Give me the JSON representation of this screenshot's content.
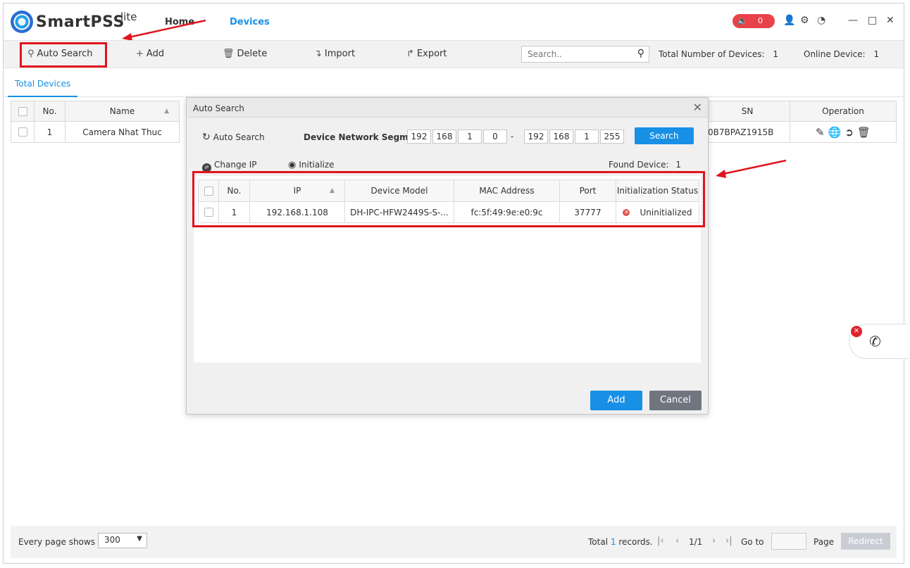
{
  "app": {
    "name": "SmartPSS",
    "suffix": "lite"
  },
  "nav": {
    "home": "Home",
    "devices": "Devices"
  },
  "header": {
    "alarm_count": "0"
  },
  "toolbar": {
    "auto_search": "Auto Search",
    "add": "Add",
    "delete": "Delete",
    "import": "Import",
    "export": "Export",
    "search_placeholder": "Search..",
    "total_label": "Total Number of Devices:",
    "total_value": "1",
    "online_label": "Online Device:",
    "online_value": "1"
  },
  "tabs": {
    "total_devices": "Total Devices"
  },
  "device_table": {
    "columns": {
      "no": "No.",
      "name": "Name",
      "sn": "SN",
      "operation": "Operation"
    },
    "rows": [
      {
        "no": "1",
        "name": "Camera Nhat Thuc",
        "sn": "0B7BPAZ1915B"
      }
    ]
  },
  "dialog": {
    "title": "Auto Search",
    "auto_search": "Auto Search",
    "segment_label": "Device Network Segm...",
    "start_ip": [
      "192",
      "168",
      "1",
      "0"
    ],
    "end_ip": [
      "192",
      "168",
      "1",
      "255"
    ],
    "dash": "-",
    "search_button": "Search",
    "change_ip": "Change IP",
    "initialize": "Initialize",
    "found_label": "Found Device:",
    "found_value": "1",
    "columns": {
      "no": "No.",
      "ip": "IP",
      "model": "Device Model",
      "mac": "MAC Address",
      "port": "Port",
      "status": "Initialization Status"
    },
    "rows": [
      {
        "no": "1",
        "ip": "192.168.1.108",
        "model": "DH-IPC-HFW2449S-S-...",
        "mac": "fc:5f:49:9e:e0:9c",
        "port": "37777",
        "status": "Uninitialized"
      }
    ],
    "add_button": "Add",
    "cancel_button": "Cancel"
  },
  "footer": {
    "per_page_label": "Every page shows",
    "per_page_value": "300",
    "total_prefix": "Total",
    "total_count": "1",
    "total_suffix": "records.",
    "page_indicator": "1/1",
    "goto_label": "Go to",
    "page_label": "Page",
    "redirect": "Redirect"
  },
  "colors": {
    "accent": "#1890e6",
    "annotation_red": "#e0141e",
    "alarm_red": "#e8434a"
  }
}
